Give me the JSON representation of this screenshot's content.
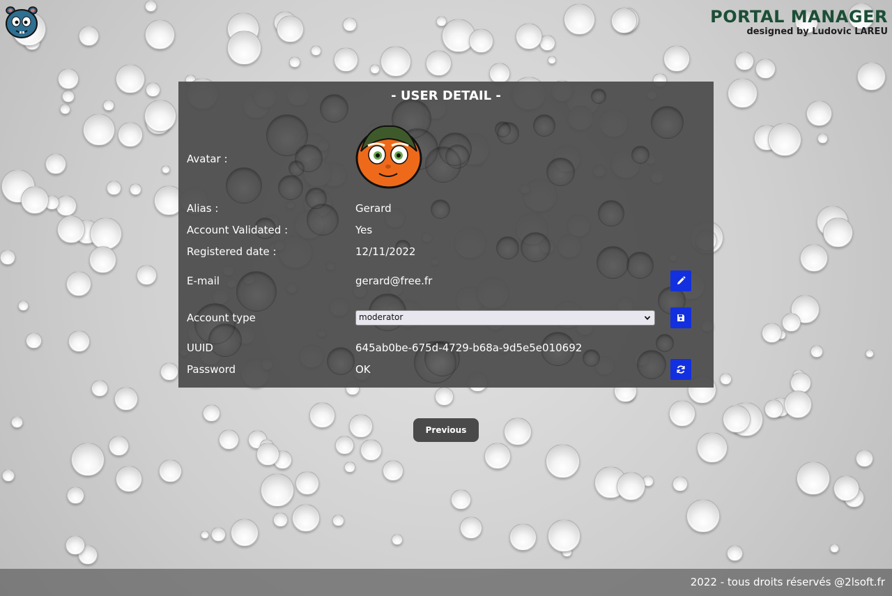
{
  "brand": {
    "title": "PORTAL MANAGER",
    "subtitle": "designed by Ludovic LAREU"
  },
  "panel": {
    "title": "- USER DETAIL -",
    "avatar_label": "Avatar :",
    "alias_label": "Alias :",
    "alias_value": "Gerard",
    "validated_label": "Account Validated :",
    "validated_value": "Yes",
    "registered_label": "Registered date :",
    "registered_value": "12/11/2022",
    "email_label": "E-mail",
    "email_value": "gerard@free.fr",
    "account_type_label": "Account type",
    "account_type_value": "moderator",
    "uuid_label": "UUID",
    "uuid_value": "645ab0be-675d-4729-b68a-9d5e5e010692",
    "password_label": "Password",
    "password_value": "OK"
  },
  "icons": {
    "edit": "pencil-icon",
    "save": "floppy-disk-icon",
    "reset": "refresh-icon",
    "select_arrow": "chevron-down-icon"
  },
  "colors": {
    "brand_title": "#1c4e36",
    "action_button": "#1330e0",
    "panel_background": "#4b4b4b"
  },
  "nav": {
    "previous_label": "Previous"
  },
  "footer": {
    "text": "2022 - tous droits réservés @2lsoft.fr"
  }
}
